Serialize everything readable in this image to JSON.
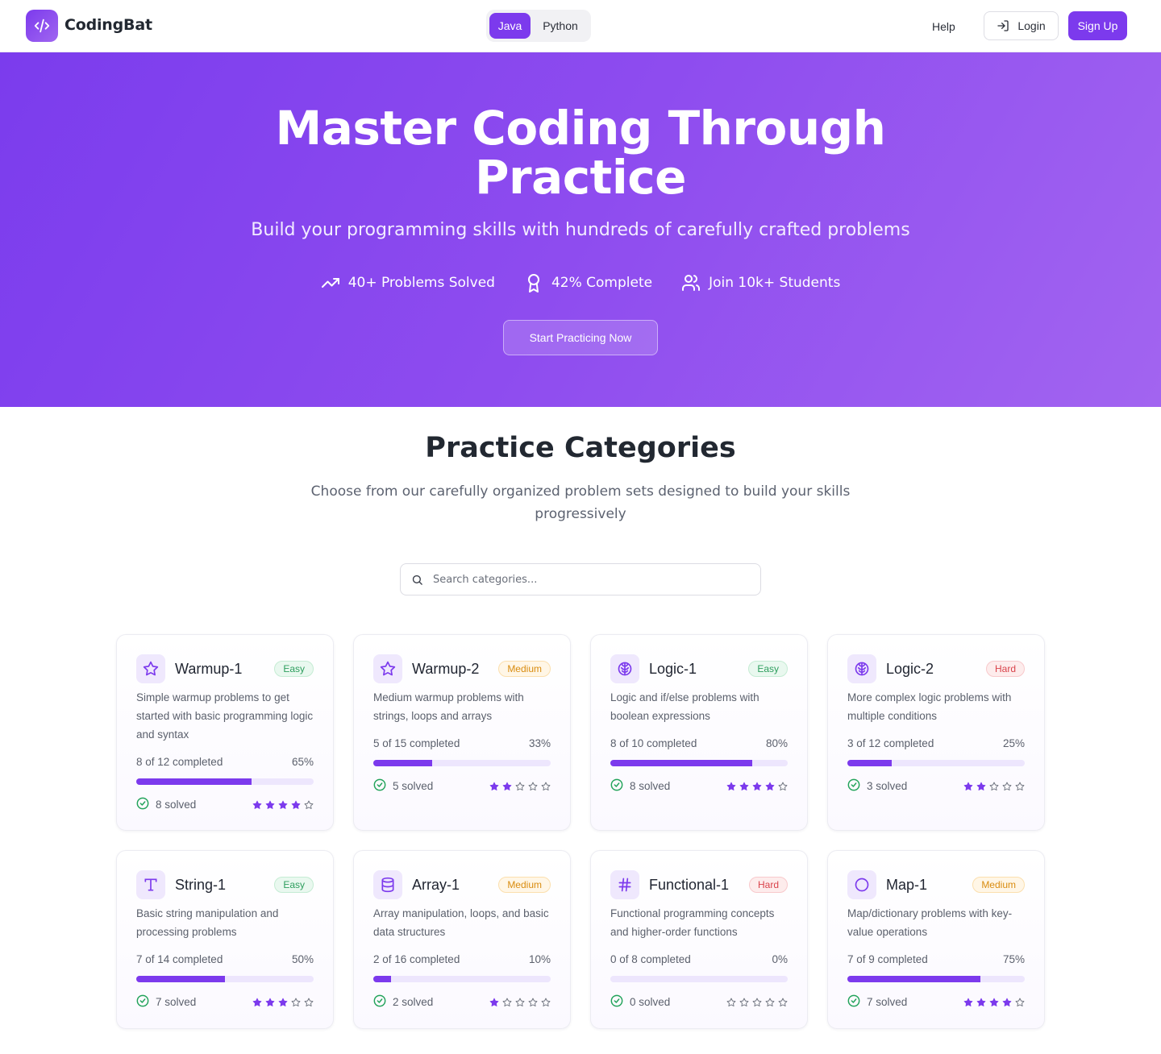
{
  "brand": {
    "name": "CodingBat"
  },
  "nav": {
    "languages": [
      "Java",
      "Python"
    ],
    "active_language": "Java",
    "help_label": "Help",
    "login_label": "Login",
    "signup_label": "Sign Up"
  },
  "hero": {
    "title": "Master Coding Through Practice",
    "subtitle": "Build your programming skills with hundreds of carefully crafted problems",
    "stats": [
      {
        "icon": "trending-up-icon",
        "label": "40+ Problems Solved"
      },
      {
        "icon": "award-icon",
        "label": "42% Complete"
      },
      {
        "icon": "users-icon",
        "label": "Join 10k+ Students"
      }
    ],
    "cta_label": "Start Practicing Now"
  },
  "categories_section": {
    "title": "Practice Categories",
    "subtitle": "Choose from our carefully organized problem sets designed to build your skills progressively",
    "search_placeholder": "Search categories..."
  },
  "categories": [
    {
      "name": "Warmup-1",
      "icon": "star-icon",
      "difficulty": "Easy",
      "description": "Simple warmup problems to get started with basic programming logic and syntax",
      "progress_text": "8 of 12 completed",
      "percent_label": "65%",
      "progress": 0.65,
      "solved_label": "8 solved",
      "rating": 4
    },
    {
      "name": "Warmup-2",
      "icon": "star-icon",
      "difficulty": "Medium",
      "description": "Medium warmup problems with strings, loops and arrays",
      "progress_text": "5 of 15 completed",
      "percent_label": "33%",
      "progress": 0.33,
      "solved_label": "5 solved",
      "rating": 2
    },
    {
      "name": "Logic-1",
      "icon": "brain-icon",
      "difficulty": "Easy",
      "description": "Logic and if/else problems with boolean expressions",
      "progress_text": "8 of 10 completed",
      "percent_label": "80%",
      "progress": 0.8,
      "solved_label": "8 solved",
      "rating": 4
    },
    {
      "name": "Logic-2",
      "icon": "brain-icon",
      "difficulty": "Hard",
      "description": "More complex logic problems with multiple conditions",
      "progress_text": "3 of 12 completed",
      "percent_label": "25%",
      "progress": 0.25,
      "solved_label": "3 solved",
      "rating": 2
    },
    {
      "name": "String-1",
      "icon": "type-icon",
      "difficulty": "Easy",
      "description": "Basic string manipulation and processing problems",
      "progress_text": "7 of 14 completed",
      "percent_label": "50%",
      "progress": 0.5,
      "solved_label": "7 solved",
      "rating": 3
    },
    {
      "name": "Array-1",
      "icon": "database-icon",
      "difficulty": "Medium",
      "description": "Array manipulation, loops, and basic data structures",
      "progress_text": "2 of 16 completed",
      "percent_label": "10%",
      "progress": 0.1,
      "solved_label": "2 solved",
      "rating": 1
    },
    {
      "name": "Functional-1",
      "icon": "hash-icon",
      "difficulty": "Hard",
      "description": "Functional programming concepts and higher-order functions",
      "progress_text": "0 of 8 completed",
      "percent_label": "0%",
      "progress": 0.0,
      "solved_label": "0 solved",
      "rating": 0
    },
    {
      "name": "Map-1",
      "icon": "circle-icon",
      "difficulty": "Medium",
      "description": "Map/dictionary problems with key-value operations",
      "progress_text": "7 of 9 completed",
      "percent_label": "75%",
      "progress": 0.75,
      "solved_label": "7 solved",
      "rating": 4
    }
  ],
  "colors": {
    "accent": "#7c3aed",
    "hero_start": "#7b3ced",
    "hero_end": "#a264f0",
    "easy": "#2e9e5e",
    "medium": "#d98c10",
    "hard": "#d9434b",
    "success_check": "#22a35a"
  }
}
